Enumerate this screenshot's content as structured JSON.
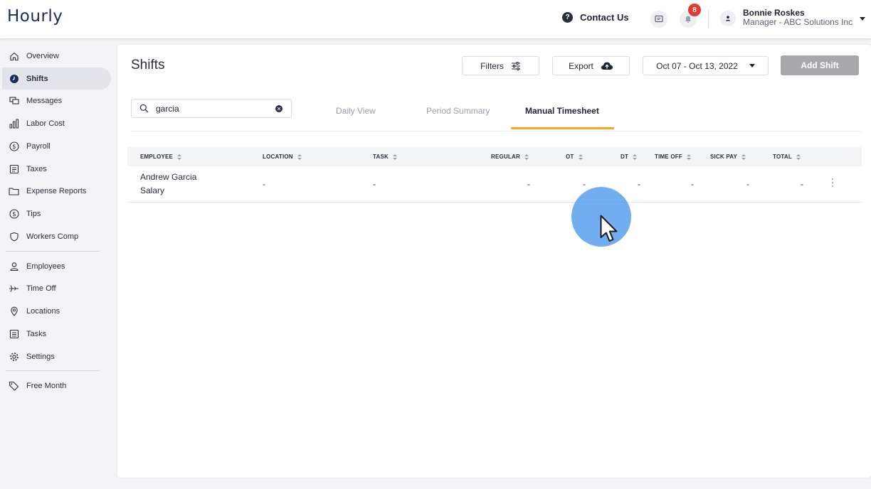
{
  "app": {
    "logo": "Hourly"
  },
  "header": {
    "contact_label": "Contact Us",
    "notification_count": "8",
    "user_name": "Bonnie Roskes",
    "user_role": "Manager - ABC Solutions Inc"
  },
  "sidebar": {
    "items": [
      {
        "label": "Overview",
        "icon": "home-icon"
      },
      {
        "label": "Shifts",
        "icon": "clock-icon",
        "active": true
      },
      {
        "label": "Messages",
        "icon": "chat-icon"
      },
      {
        "label": "Labor Cost",
        "icon": "bar-chart-icon"
      },
      {
        "label": "Payroll",
        "icon": "dollar-circle-icon"
      },
      {
        "label": "Taxes",
        "icon": "document-icon"
      },
      {
        "label": "Expense Reports",
        "icon": "folder-icon"
      },
      {
        "label": "Tips",
        "icon": "dollar-circle-icon"
      },
      {
        "label": "Workers Comp",
        "icon": "shield-icon"
      },
      {
        "label": "Employees",
        "icon": "person-icon"
      },
      {
        "label": "Time Off",
        "icon": "plane-icon"
      },
      {
        "label": "Locations",
        "icon": "pin-icon"
      },
      {
        "label": "Tasks",
        "icon": "list-icon"
      },
      {
        "label": "Settings",
        "icon": "gear-icon"
      },
      {
        "label": "Free Month",
        "icon": "tag-icon"
      }
    ]
  },
  "main": {
    "title": "Shifts",
    "filters_label": "Filters",
    "export_label": "Export",
    "date_range": "Oct 07 - Oct 13, 2022",
    "add_shift_label": "Add Shift",
    "search_value": "garcia",
    "tabs": [
      {
        "label": "Daily View"
      },
      {
        "label": "Period Summary"
      },
      {
        "label": "Manual Timesheet",
        "active": true
      }
    ],
    "table": {
      "columns": [
        "EMPLOYEE",
        "LOCATION",
        "TASK",
        "REGULAR",
        "OT",
        "DT",
        "TIME OFF",
        "SICK PAY",
        "TOTAL"
      ],
      "rows": [
        {
          "employee": "Andrew Garcia",
          "pay_type": "Salary",
          "location": "-",
          "task": "-",
          "regular": "-",
          "ot": "-",
          "dt": "-",
          "time_off": "-",
          "sick_pay": "-",
          "total": "-"
        }
      ]
    }
  },
  "colors": {
    "accent": "#f5a623",
    "brand": "#1c2a5c",
    "badge": "#e53935",
    "add_button": "#a7a8ac",
    "cursor_highlight": "#4a96eb"
  }
}
